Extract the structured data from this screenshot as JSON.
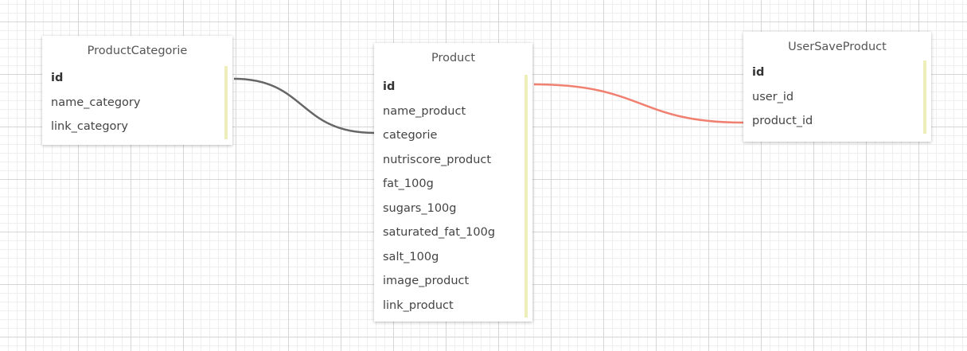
{
  "entities": [
    {
      "title": "ProductCategorie",
      "fields": [
        {
          "name": "id",
          "primary": true
        },
        {
          "name": "name_category",
          "primary": false
        },
        {
          "name": "link_category",
          "primary": false
        }
      ]
    },
    {
      "title": "Product",
      "fields": [
        {
          "name": "id",
          "primary": true
        },
        {
          "name": "name_product",
          "primary": false
        },
        {
          "name": "categorie",
          "primary": false
        },
        {
          "name": "nutriscore_product",
          "primary": false
        },
        {
          "name": "fat_100g",
          "primary": false
        },
        {
          "name": "sugars_100g",
          "primary": false
        },
        {
          "name": "saturated_fat_100g",
          "primary": false
        },
        {
          "name": "salt_100g",
          "primary": false
        },
        {
          "name": "image_product",
          "primary": false
        },
        {
          "name": "link_product",
          "primary": false
        }
      ]
    },
    {
      "title": "UserSaveProduct",
      "fields": [
        {
          "name": "id",
          "primary": true
        },
        {
          "name": "user_id",
          "primary": false
        },
        {
          "name": "product_id",
          "primary": false
        }
      ]
    }
  ],
  "relations": [
    {
      "from": "ProductCategorie.id",
      "to": "Product.categorie",
      "color": "#666666"
    },
    {
      "from": "Product.id",
      "to": "UserSaveProduct.product_id",
      "color": "#f08070"
    }
  ],
  "colors": {
    "grid_major": "#d6d6d6",
    "grid_minor": "#efefef",
    "field_marker": "#eeeebb"
  }
}
